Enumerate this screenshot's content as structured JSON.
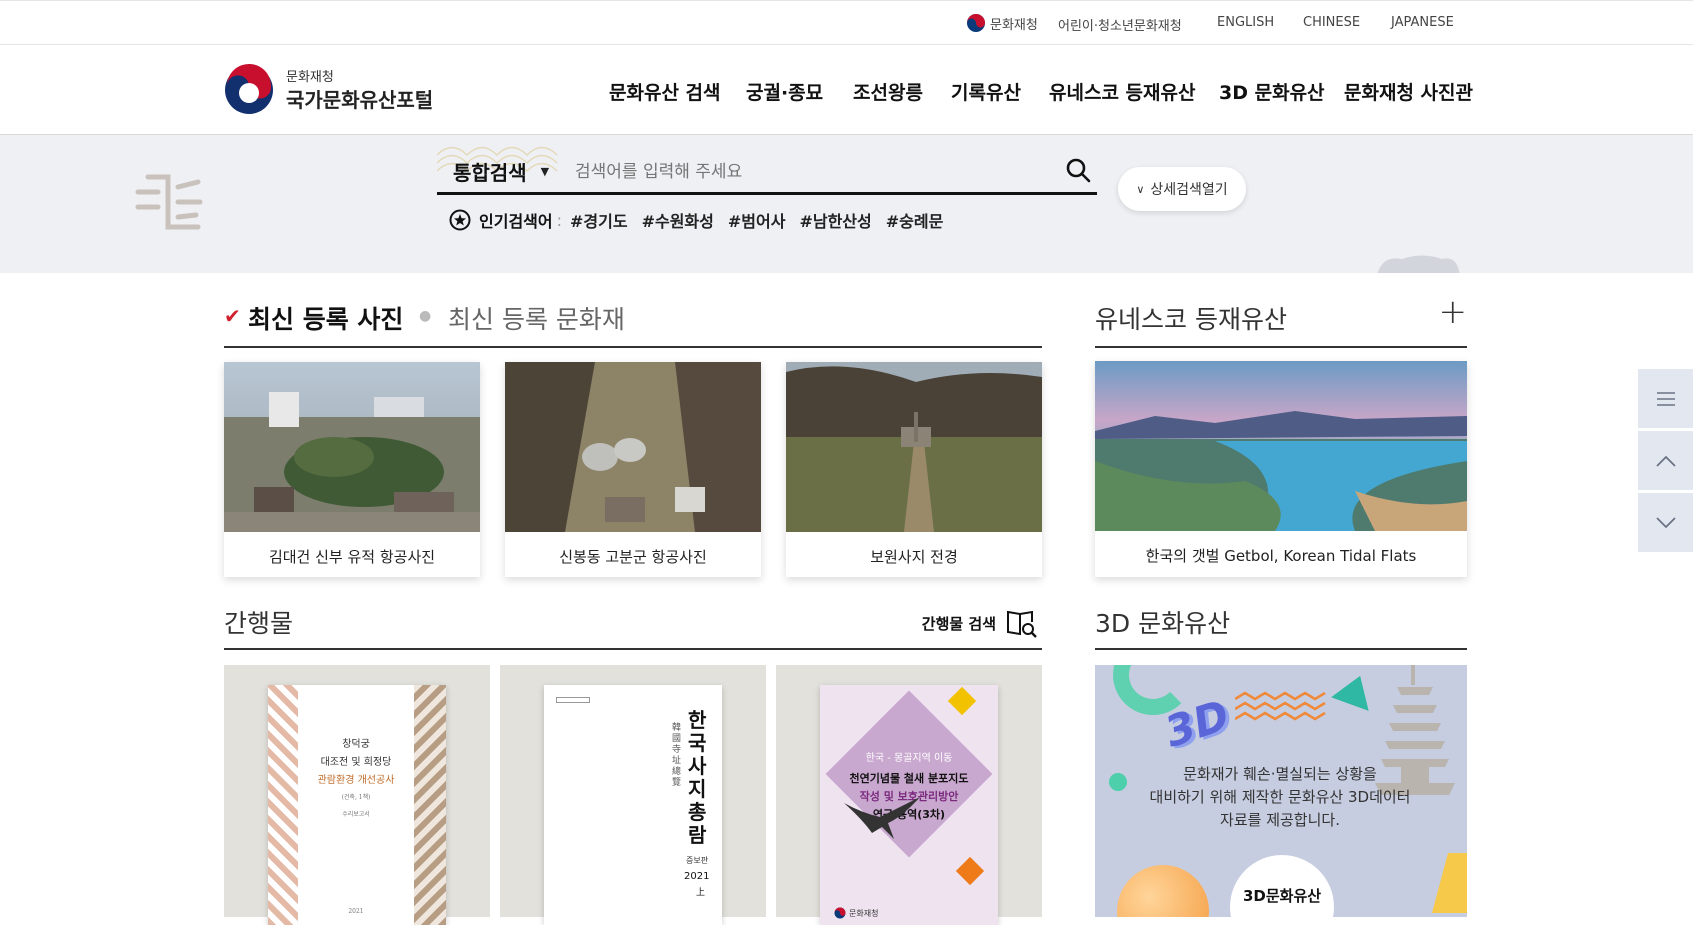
{
  "util": {
    "agency": "문화재청",
    "kids": "어린이·청소년문화재청",
    "lang_en": "ENGLISH",
    "lang_cn": "CHINESE",
    "lang_jp": "JAPANESE"
  },
  "header": {
    "logo_sub": "문화재청",
    "logo_main": "국가문화유산포털",
    "nav": [
      "문화유산 검색",
      "궁궐·종묘",
      "조선왕릉",
      "기록유산",
      "유네스코 등재유산",
      "3D 문화유산",
      "문화재청 사진관"
    ]
  },
  "search": {
    "scope": "통합검색",
    "placeholder": "검색어를 입력해 주세요",
    "detail_button": "상세검색열기",
    "popular_label": "인기검색어",
    "tags": [
      "#경기도",
      "#수원화성",
      "#범어사",
      "#남한산성",
      "#숭례문"
    ]
  },
  "latest": {
    "tab_active": "최신 등록 사진",
    "tab_inactive": "최신 등록 문화재",
    "items": [
      {
        "caption": "김대건 신부 유적 항공사진"
      },
      {
        "caption": "신봉동 고분군 항공사진"
      },
      {
        "caption": "보원사지 전경"
      }
    ]
  },
  "unesco": {
    "title": "유네스코 등재유산",
    "more": "+",
    "caption": "한국의 갯벌 Getbol, Korean Tidal Flats"
  },
  "publications": {
    "title": "간행물",
    "search_label": "간행물 검색",
    "books": [
      {
        "title_lines": [
          "창덕궁",
          "대조전 및 희정당",
          "관람환경 개선공사"
        ],
        "sub": "(건축, 1책)",
        "footer": "수리보고서",
        "year": "2021"
      },
      {
        "title": "한국사지총람",
        "hanja": "韓國寺址總覽",
        "edition": "증보판",
        "year": "2021",
        "vol": "上"
      },
      {
        "top": "한국 - 몽골지역 이동",
        "lines": [
          "천연기념물 철새 분포지도",
          "작성 및 보호관리방안",
          "연구 용역(3차)"
        ],
        "publisher": "문화재청"
      }
    ]
  },
  "threeD": {
    "title": "3D 문화유산",
    "badge": "3D",
    "desc_lines": [
      "문화재가 훼손·멸실되는 상황을",
      "대비하기 위해 제작한 문화유산 3D데이터",
      "자료를 제공합니다."
    ],
    "button": "3D문화유산"
  },
  "quick": {
    "menu_icon": "menu-icon",
    "up_icon": "chevron-up-icon",
    "down_icon": "chevron-down-icon"
  }
}
